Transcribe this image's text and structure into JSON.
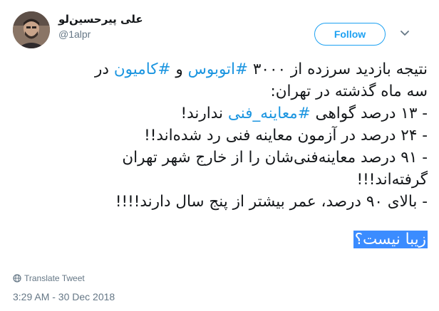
{
  "author": {
    "display_name": "علی پیرحسین‌لو",
    "handle": "@1alpr"
  },
  "follow_label": "Follow",
  "tweet": {
    "line1": {
      "pre": "نتیجه بازدید سرزده از ۳۰۰۰ ",
      "tag1": "#اتوبوس",
      "mid": " و ",
      "tag2": "#کامیون",
      "post": " در"
    },
    "line2": "سه ماه گذشته در تهران:",
    "line3": {
      "pre": "- ۱۳ درصد گواهی ",
      "tag": "#معاینه_فنی",
      "post": " ندارند!"
    },
    "line4": "- ۲۴ درصد در آزمون معاینه فنی رد شده‌اند!!",
    "line5": "- ۹۱ درصد معاینه‌فنی‌شان را از خارج شهر تهران",
    "line6": "گرفته‌اند!!!",
    "line7": "- بالای ۹۰ درصد، عمر بیشتر از پنج سال دارند!!!!",
    "line8": "زیبا نیست؟"
  },
  "translate_label": "Translate Tweet",
  "timestamp": "3:29 AM - 30 Dec 2018",
  "colors": {
    "accent": "#1da1f2",
    "hashtag": "#1b95e0",
    "muted": "#657786",
    "highlight": "#3b8cff"
  },
  "icons": [
    "avatar",
    "chevron-down-icon",
    "globe-icon"
  ]
}
